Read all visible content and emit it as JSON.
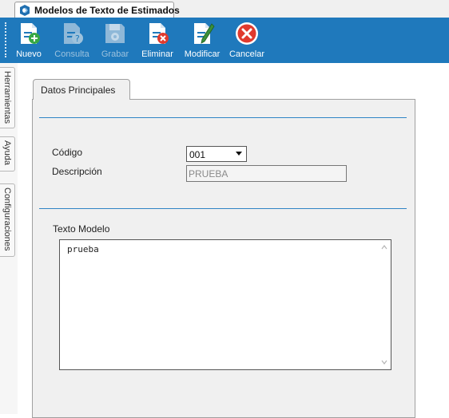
{
  "window": {
    "title": "Modelos de Texto de Estimados",
    "icon": "app-logo-icon"
  },
  "toolbar": {
    "buttons": [
      {
        "label": "Nuevo",
        "icon": "new-document-icon",
        "enabled": true
      },
      {
        "label": "Consulta",
        "icon": "query-document-icon",
        "enabled": false
      },
      {
        "label": "Grabar",
        "icon": "save-disk-icon",
        "enabled": false
      },
      {
        "label": "Eliminar",
        "icon": "delete-document-icon",
        "enabled": true
      },
      {
        "label": "Modificar",
        "icon": "edit-document-icon",
        "enabled": true
      },
      {
        "label": "Cancelar",
        "icon": "cancel-icon",
        "enabled": true
      }
    ]
  },
  "side_tabs": [
    "Herramientas",
    "Ayuda",
    "Configuraciones"
  ],
  "panel": {
    "tab_label": "Datos Principales",
    "fields": {
      "codigo_label": "Código",
      "codigo_value": "001",
      "descripcion_label": "Descripción",
      "descripcion_value": "PRUEBA"
    },
    "texto_modelo_label": "Texto Modelo",
    "texto_modelo_value": "prueba"
  },
  "colors": {
    "toolbar_bg": "#1f79bc",
    "accent_line": "#2f84c5",
    "panel_bg": "#f0f0f0",
    "cancel_red": "#e03a2e"
  }
}
